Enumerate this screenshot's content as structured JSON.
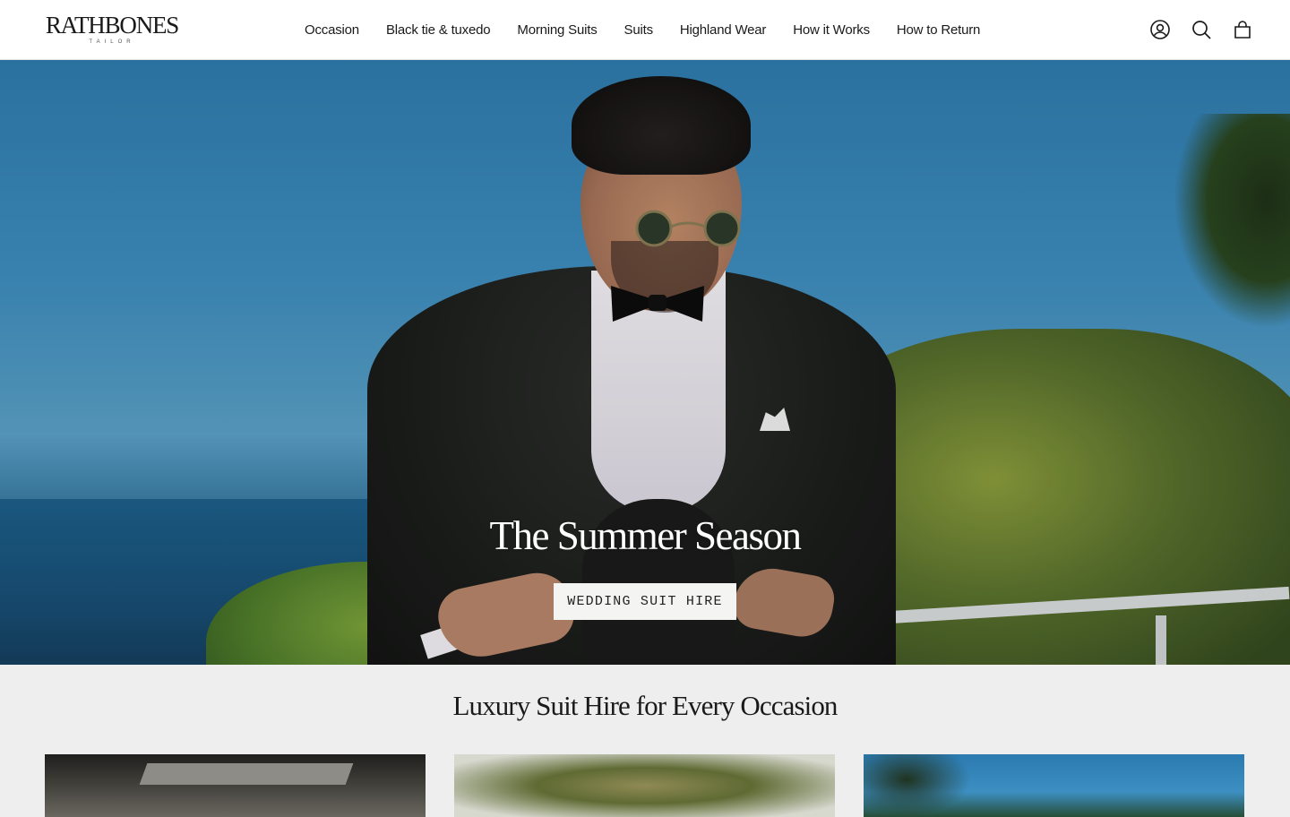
{
  "brand": {
    "name": "RATHBONES",
    "tagline": "TAILOR"
  },
  "nav": {
    "items": [
      {
        "label": "Occasion"
      },
      {
        "label": "Black tie & tuxedo"
      },
      {
        "label": "Morning Suits"
      },
      {
        "label": "Suits"
      },
      {
        "label": "Highland Wear"
      },
      {
        "label": "How it Works"
      },
      {
        "label": "How to Return"
      }
    ]
  },
  "header_icons": [
    "account-icon",
    "search-icon",
    "cart-icon"
  ],
  "hero": {
    "title": "The Summer Season",
    "cta_label": "WEDDING SUIT HIRE"
  },
  "section": {
    "title": "Luxury Suit Hire for Every Occasion"
  },
  "colors": {
    "header_bg": "#ffffff",
    "page_bg": "#eeeeee",
    "text": "#1a1a1a",
    "cta_bg": "#f4f4f2"
  }
}
